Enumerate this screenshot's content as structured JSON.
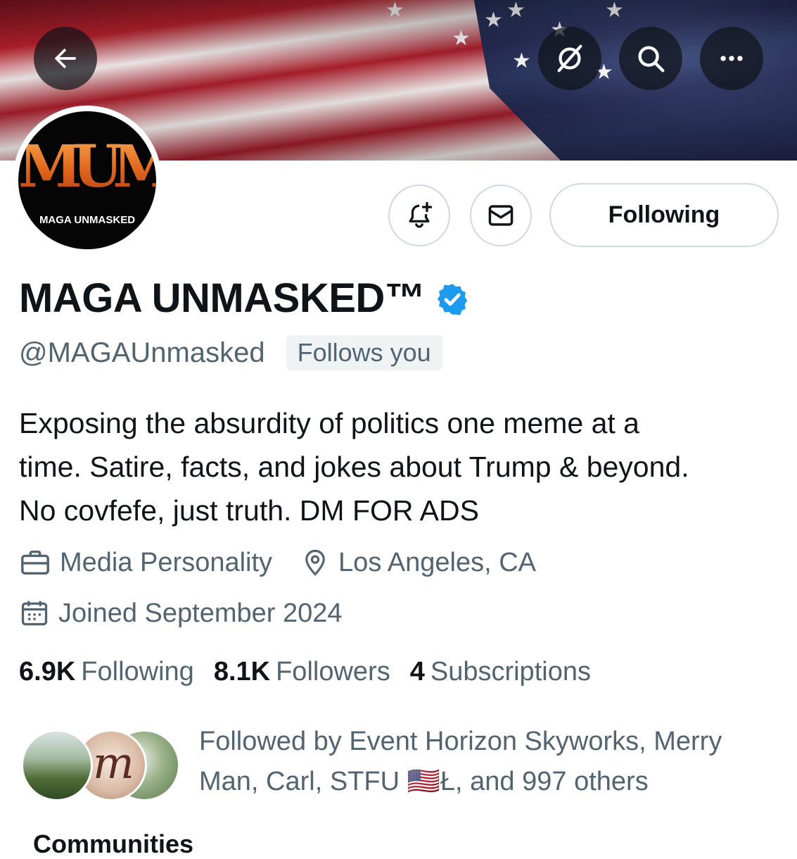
{
  "header": {
    "back_icon": "arrow-left-icon",
    "grok_icon": "grok-icon",
    "search_icon": "search-icon",
    "more_icon": "more-horizontal-icon"
  },
  "avatar": {
    "logo_letters": "MUM",
    "logo_text": "MAGA UNMASKED"
  },
  "actions": {
    "notify_icon": "bell-plus-icon",
    "message_icon": "mail-icon",
    "following_label": "Following"
  },
  "profile": {
    "display_name": "MAGA UNMASKED™",
    "handle": "@MAGAUnmasked",
    "follows_you": "Follows you",
    "bio_line1": "Exposing the absurdity of politics one meme at a",
    "bio_line2": "time. Satire, facts, and jokes about Trump & beyond.",
    "bio_line3": "No covfefe, just truth. DM FOR ADS",
    "category": "Media Personality",
    "location": "Los Angeles, CA",
    "joined": "Joined September 2024"
  },
  "stats": {
    "following_count": "6.9K",
    "following_label": "Following",
    "followers_count": "8.1K",
    "followers_label": "Followers",
    "subscriptions_count": "4",
    "subscriptions_label": "Subscriptions"
  },
  "followed_by": {
    "line1": "Followed by Event Horizon Skyworks, Merry",
    "line2": "Man, Carl, STFU 🇺🇸Ł, and 997 others"
  },
  "tabs": {
    "communities_label": "Communities"
  },
  "colors": {
    "accent_blue": "#1d9bf0",
    "secondary_text": "#536471",
    "primary_text": "#0f1419",
    "border": "#cfd9de",
    "logo_orange": "#e87b2a"
  }
}
